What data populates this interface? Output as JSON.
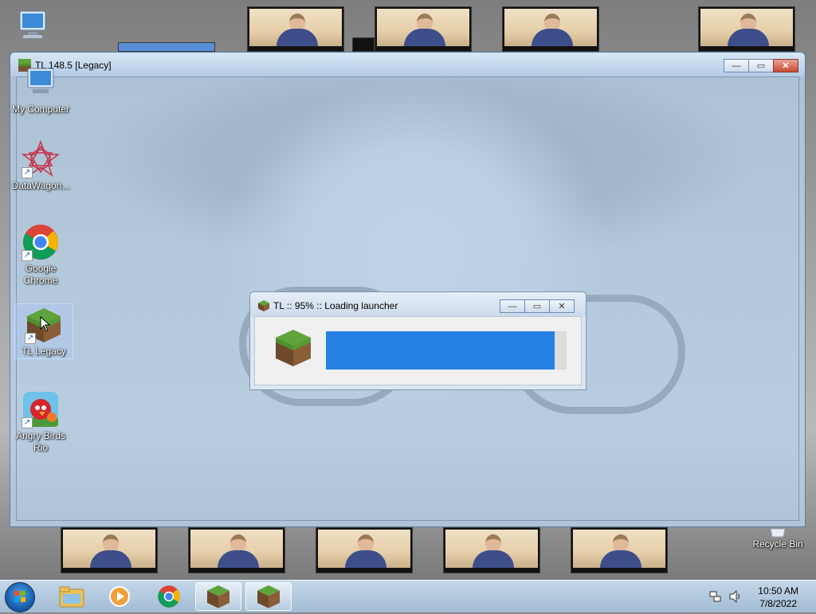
{
  "desktop": {
    "icons": [
      {
        "label": "My Computer"
      },
      {
        "label": "DataWagon..."
      },
      {
        "label": "Google Chrome"
      },
      {
        "label": "TL Legacy"
      },
      {
        "label": "Angry Birds Rio"
      },
      {
        "label": "Recycle Bin"
      }
    ]
  },
  "main_window": {
    "title": "TL 148.5 [Legacy]",
    "buttons": {
      "minimize": "—",
      "maximize": "▭",
      "close": "✕"
    }
  },
  "dialog": {
    "title": "TL :: 95% :: Loading launcher",
    "progress": 0.95,
    "buttons": {
      "minimize": "—",
      "maximize": "▭",
      "close": "✕"
    }
  },
  "taskbar": {
    "items": [
      "start",
      "windows-explorer",
      "media-player",
      "google-chrome",
      "tl-legacy",
      "tl-legacy-loader"
    ],
    "clock": {
      "time": "10:50 AM",
      "date": "7/8/2022"
    }
  },
  "colors": {
    "progress": "#2780e3",
    "grass_top": "#5fa43b",
    "dirt": "#7a5330"
  }
}
